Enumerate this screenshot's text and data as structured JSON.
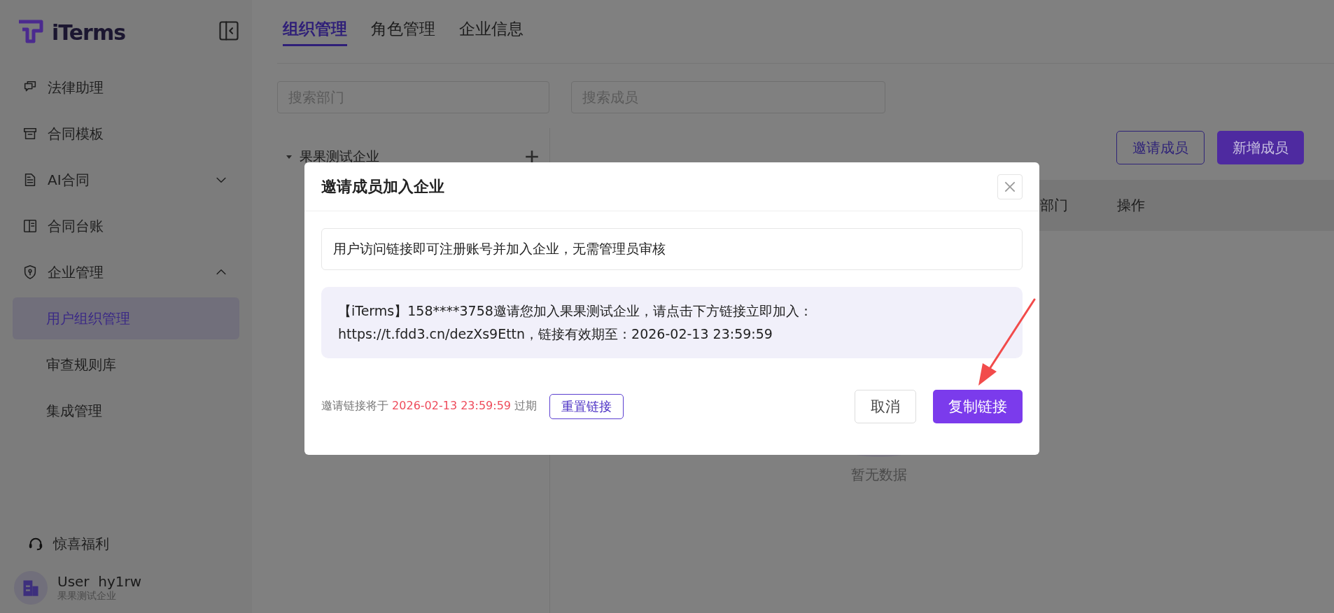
{
  "sidebar": {
    "logo": "iTerms",
    "items": [
      {
        "label": "法律助理"
      },
      {
        "label": "合同模板"
      },
      {
        "label": "AI合同",
        "expanded": false
      },
      {
        "label": "合同台账"
      },
      {
        "label": "企业管理",
        "expanded": true,
        "children": [
          {
            "label": "用户组织管理",
            "selected": true
          },
          {
            "label": "审查规则库",
            "selected": false
          },
          {
            "label": "集成管理",
            "selected": false
          }
        ]
      }
    ],
    "bonus": "惊喜福利",
    "user": {
      "name": "User  hy1rw",
      "company": "果果测试企业"
    }
  },
  "tabs": [
    {
      "label": "组织管理",
      "selected": true
    },
    {
      "label": "角色管理",
      "selected": false
    },
    {
      "label": "企业信息",
      "selected": false
    }
  ],
  "search": {
    "department_placeholder": "搜索部门",
    "member_placeholder": "搜索成员"
  },
  "tree": [
    {
      "label": "果果测试企业",
      "expanded": true
    }
  ],
  "actions": [
    {
      "label": "邀请成员",
      "kind": "outline"
    },
    {
      "label": "新增成员",
      "kind": "primary"
    }
  ],
  "table": {
    "columns": [
      "部门",
      "操作"
    ],
    "empty_text": "暂无数据"
  },
  "dialog": {
    "title": "邀请成员加入企业",
    "notice": "用户访问链接即可注册账号并加入企业，无需管理员审核",
    "message_lines": [
      "【iTerms】158****3758邀请您加入果果测试企业，请点击下方链接立即加入：",
      "https://t.fdd3.cn/dezXs9Ettn，链接有效期至：2026-02-13 23:59:59"
    ],
    "expiry_prefix": "邀请链接将于",
    "expiry_date": "2026-02-13 23:59:59",
    "expiry_suffix": "过期",
    "reset_button": "重置链接",
    "buttons": [
      {
        "label": "取消",
        "kind": "default"
      },
      {
        "label": "复制链接",
        "kind": "primary"
      }
    ]
  }
}
